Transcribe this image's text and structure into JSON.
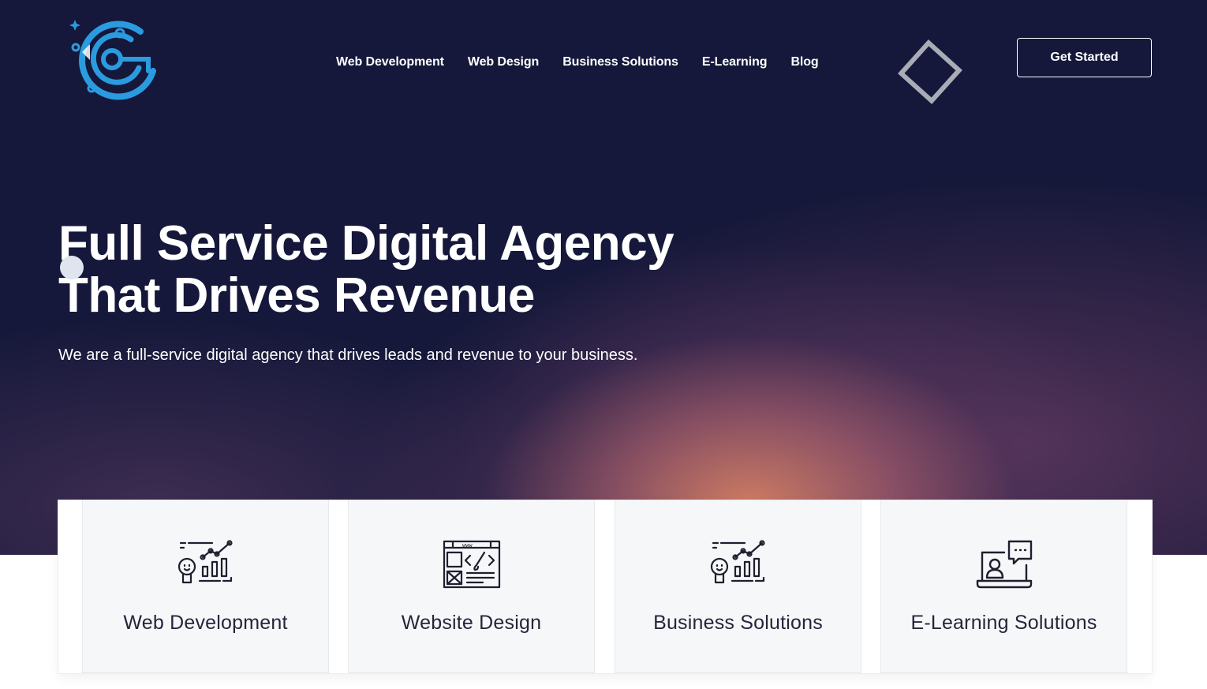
{
  "header": {
    "logo_name": "agency-logo",
    "nav": [
      {
        "label": "Web Development"
      },
      {
        "label": "Web Design"
      },
      {
        "label": "Business Solutions"
      },
      {
        "label": "E-Learning"
      },
      {
        "label": "Blog"
      }
    ],
    "cta_label": "Get Started"
  },
  "hero": {
    "title_line1": "Full Service Digital Agency",
    "title_line2": "That Drives Revenue",
    "subtitle": "We are a full-service digital agency that drives leads and revenue to your business."
  },
  "services": [
    {
      "label": "Web Development",
      "icon": "analytics-bulb-icon"
    },
    {
      "label": "Website Design",
      "icon": "web-design-icon"
    },
    {
      "label": "Business Solutions",
      "icon": "analytics-bulb-icon"
    },
    {
      "label": "E-Learning Solutions",
      "icon": "laptop-chat-icon"
    }
  ],
  "colors": {
    "hero_bg": "#15183a",
    "logo_blue": "#2b9be0",
    "accent_glow": "#d68064",
    "card_bg": "#f6f7f9"
  }
}
